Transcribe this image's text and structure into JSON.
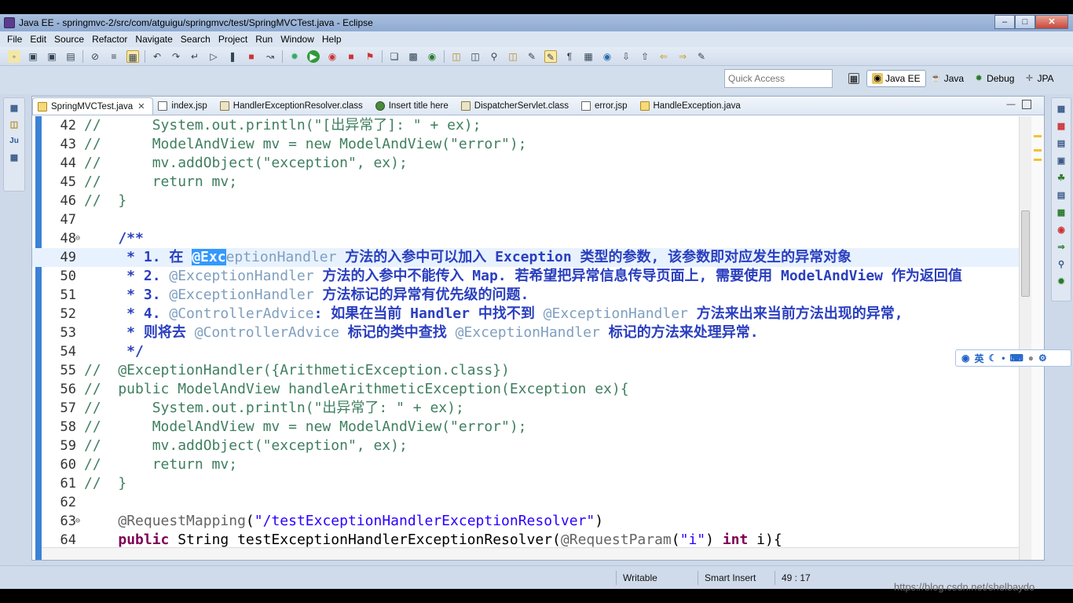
{
  "window": {
    "title": "Java EE - springmvc-2/src/com/atguigu/springmvc/test/SpringMVCTest.java - Eclipse"
  },
  "menu": [
    "File",
    "Edit",
    "Source",
    "Refactor",
    "Navigate",
    "Search",
    "Project",
    "Run",
    "Window",
    "Help"
  ],
  "quick_access": {
    "placeholder": "Quick Access"
  },
  "perspectives": [
    {
      "label": "Java EE",
      "active": true
    },
    {
      "label": "Java",
      "active": false
    },
    {
      "label": "Debug",
      "active": false
    },
    {
      "label": "JPA",
      "active": false
    }
  ],
  "tabs": [
    {
      "label": "SpringMVCTest.java",
      "icon": "java-file-icon",
      "active": true
    },
    {
      "label": "index.jsp",
      "icon": "jsp-file-icon",
      "active": false
    },
    {
      "label": "HandlerExceptionResolver.class",
      "icon": "class-file-icon",
      "active": false
    },
    {
      "label": "Insert title here",
      "icon": "globe-icon",
      "active": false
    },
    {
      "label": "DispatcherServlet.class",
      "icon": "class-file-icon",
      "active": false
    },
    {
      "label": "error.jsp",
      "icon": "jsp-file-icon",
      "active": false
    },
    {
      "label": "HandleException.java",
      "icon": "java-file-icon",
      "active": false
    }
  ],
  "code_lines": [
    {
      "n": "42",
      "text": "//      System.out.println(\"[出异常了]: \" + ex);"
    },
    {
      "n": "43",
      "text": "//      ModelAndView mv = new ModelAndView(\"error\");"
    },
    {
      "n": "44",
      "text": "//      mv.addObject(\"exception\", ex);"
    },
    {
      "n": "45",
      "text": "//      return mv;"
    },
    {
      "n": "46",
      "text": "//  }"
    },
    {
      "n": "47",
      "text": ""
    },
    {
      "n": "48",
      "text": "    /**"
    },
    {
      "n": "49",
      "text": "     * 1. 在 @ExceptionHandler 方法的入参中可以加入 Exception 类型的参数, 该参数即对应发生的异常对象"
    },
    {
      "n": "50",
      "text": "     * 2. @ExceptionHandler 方法的入参中不能传入 Map. 若希望把异常信息传导页面上, 需要使用 ModelAndView 作为返回值"
    },
    {
      "n": "51",
      "text": "     * 3. @ExceptionHandler 方法标记的异常有优先级的问题."
    },
    {
      "n": "52",
      "text": "     * 4. @ControllerAdvice: 如果在当前 Handler 中找不到 @ExceptionHandler 方法来出来当前方法出现的异常,"
    },
    {
      "n": "53",
      "text": "     * 则将去 @ControllerAdvice 标记的类中查找 @ExceptionHandler 标记的方法来处理异常."
    },
    {
      "n": "54",
      "text": "     */"
    },
    {
      "n": "55",
      "text": "//  @ExceptionHandler({ArithmeticException.class})"
    },
    {
      "n": "56",
      "text": "//  public ModelAndView handleArithmeticException(Exception ex){"
    },
    {
      "n": "57",
      "text": "//      System.out.println(\"出异常了: \" + ex);"
    },
    {
      "n": "58",
      "text": "//      ModelAndView mv = new ModelAndView(\"error\");"
    },
    {
      "n": "59",
      "text": "//      mv.addObject(\"exception\", ex);"
    },
    {
      "n": "60",
      "text": "//      return mv;"
    },
    {
      "n": "61",
      "text": "//  }"
    },
    {
      "n": "62",
      "text": ""
    },
    {
      "n": "63",
      "text": "    @RequestMapping(\"/testExceptionHandlerExceptionResolver\")"
    },
    {
      "n": "64",
      "text": "    public String testExceptionHandlerExceptionResolver(@RequestParam(\"i\") int i){"
    }
  ],
  "status": {
    "writable": "Writable",
    "insert_mode": "Smart Insert",
    "cursor": "49 : 17"
  },
  "ime": {
    "lang": "英"
  },
  "watermark": "https://blog.csdn.net/shelbaydo",
  "colors": {
    "comment": "#3f7f5f",
    "javadoc": "#2a3fbf",
    "keyword": "#7f0055",
    "string": "#2a00ff",
    "selection": "#3399ff",
    "ruler": "#3b82d6"
  }
}
